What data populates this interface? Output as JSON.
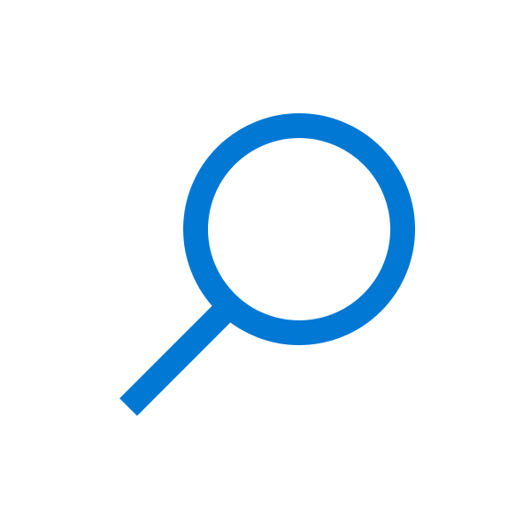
{
  "icon": {
    "name": "search-icon",
    "color": "#0078d4",
    "background": "#ffffff"
  }
}
